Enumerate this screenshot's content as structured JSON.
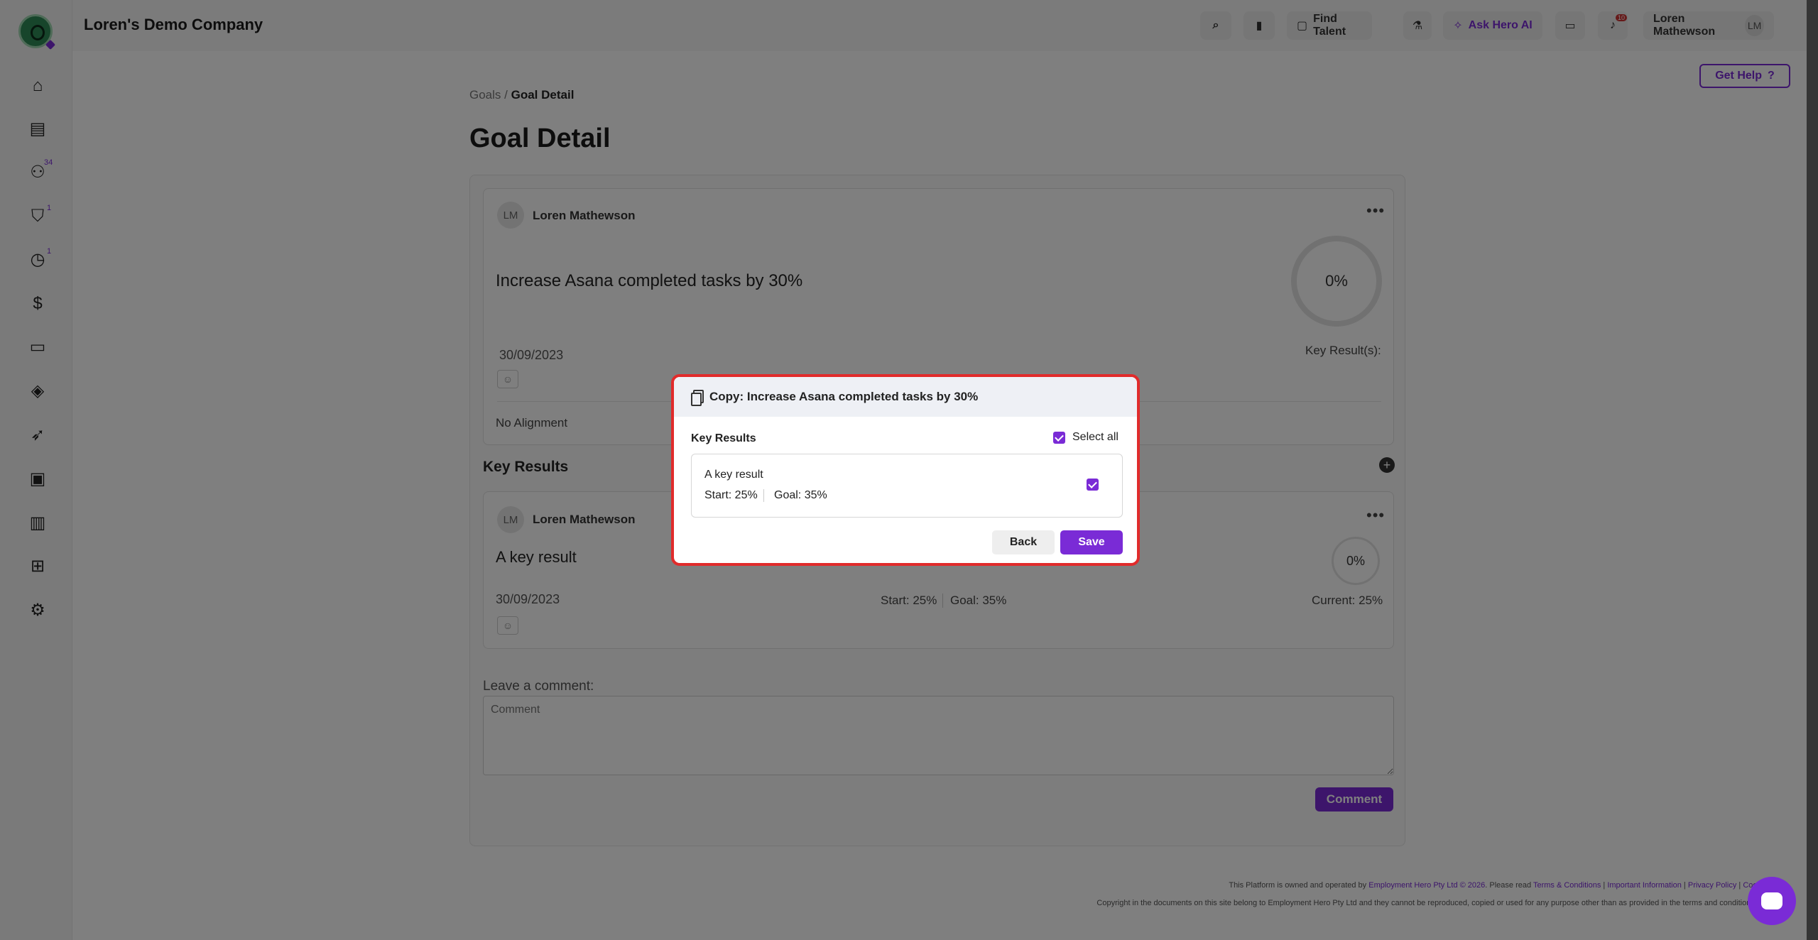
{
  "header": {
    "company": "Loren's Demo Company",
    "find_talent": "Find Talent",
    "ask_hero": "Ask Hero AI",
    "notifications_count": "10",
    "user_name": "Loren Mathewson",
    "user_initials": "LM"
  },
  "sidebar": {
    "badges": {
      "people": "34",
      "security": "1",
      "time": "1"
    }
  },
  "page": {
    "get_help": "Get Help",
    "breadcrumb_parent": "Goals",
    "breadcrumb_sep": "/",
    "breadcrumb_current": "Goal Detail",
    "title": "Goal Detail"
  },
  "goal": {
    "owner_initials": "LM",
    "owner": "Loren Mathewson",
    "title": "Increase Asana completed tasks by 30%",
    "progress": "0%",
    "progress_fraction": 0,
    "date": "30/09/2023",
    "key_results_label": "Key Result(s):",
    "alignment": "No Alignment"
  },
  "key_results": {
    "heading": "Key Results",
    "item": {
      "owner_initials": "LM",
      "owner": "Loren Mathewson",
      "title": "A key result",
      "progress": "0%",
      "date": "30/09/2023",
      "start": "Start: 25%",
      "goal": "Goal: 35%",
      "current": "Current: 25%"
    }
  },
  "comment": {
    "label": "Leave a comment:",
    "placeholder": "Comment",
    "button": "Comment"
  },
  "footer": {
    "line1_prefix": "This Platform is owned and operated by",
    "line1_company": "Employment Hero Pty Ltd © 2026",
    "line1_mid": ". Please read",
    "terms": "Terms & Conditions",
    "important": "Important Information",
    "privacy": "Privacy Policy",
    "cookies": "Cook",
    "line2": "Copyright in the documents on this site belong to Employment Hero Pty Ltd and they cannot be reproduced, copied or used for any purpose other than as provided in the terms and conditions o"
  },
  "modal": {
    "title": "Copy: Increase Asana completed tasks by 30%",
    "key_results_label": "Key Results",
    "select_all": "Select all",
    "item_name": "A key result",
    "item_start": "Start: 25%",
    "item_goal": "Goal: 35%",
    "back": "Back",
    "save": "Save"
  },
  "colors": {
    "accent": "#7a2bd6",
    "highlight_border": "#e12b2b"
  },
  "icons": {
    "logo": "company-logo",
    "nav": [
      "home-icon",
      "briefcase-icon",
      "people-icon",
      "shield-check-icon",
      "clock-icon",
      "dollar-icon",
      "chat-icon",
      "graduation-cap-icon",
      "rocket-icon",
      "gift-icon",
      "bar-chart-icon",
      "org-chart-icon",
      "gear-icon"
    ]
  }
}
